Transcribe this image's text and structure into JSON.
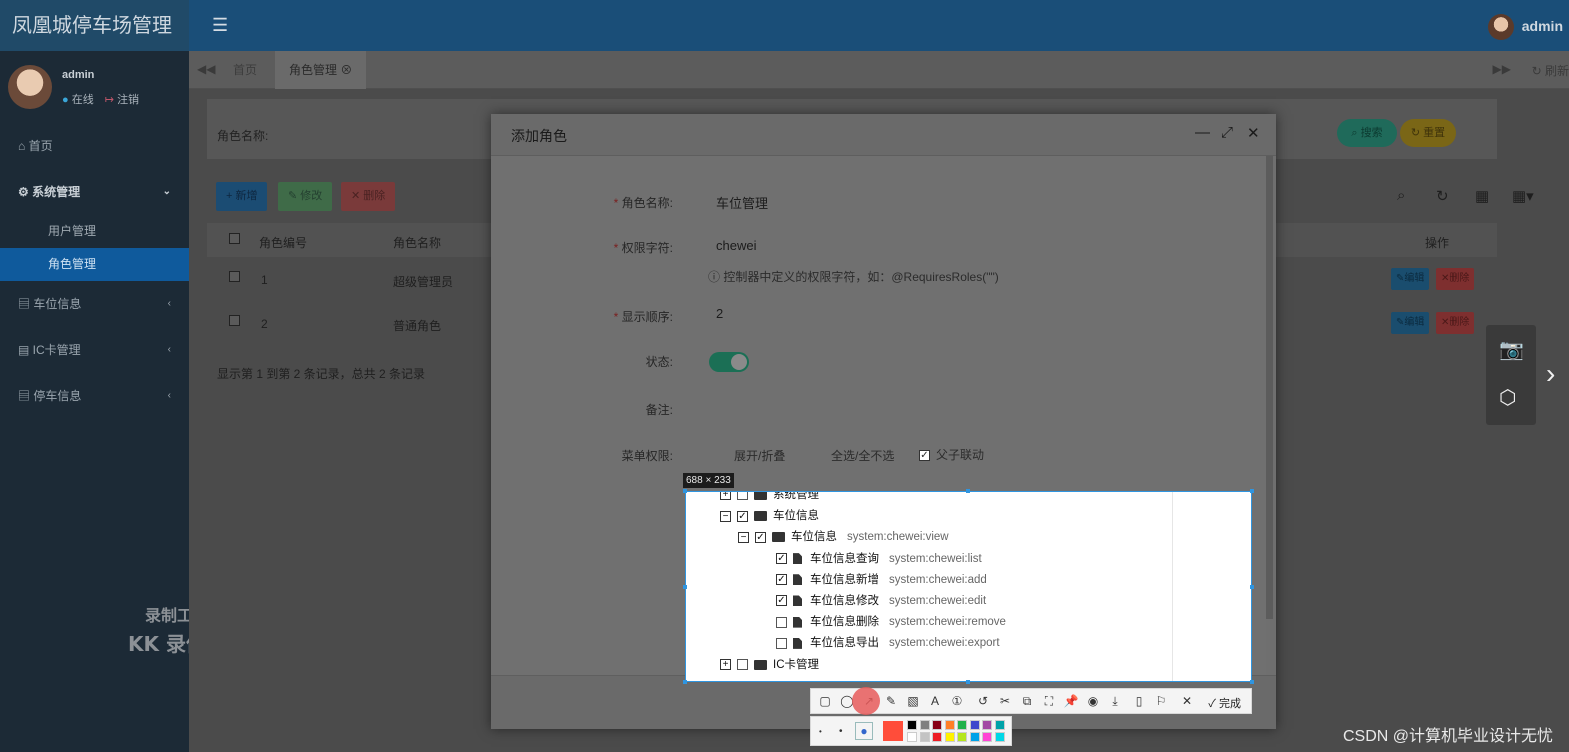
{
  "app": {
    "title": "凤凰城停车场管理",
    "user": "admin"
  },
  "sidebar": {
    "profile": {
      "name": "admin",
      "online": "在线",
      "logout": "注销"
    },
    "items": [
      {
        "label": "首页"
      },
      {
        "label": "系统管理"
      },
      {
        "label": "用户管理"
      },
      {
        "label": "角色管理"
      },
      {
        "label": "车位信息"
      },
      {
        "label": "IC卡管理"
      },
      {
        "label": "停车信息"
      }
    ]
  },
  "watermark": {
    "line1": "录制工具",
    "line2": "KK 录像机"
  },
  "tabs": {
    "home": "首页",
    "active": "角色管理",
    "refresh": "刷新"
  },
  "search": {
    "role_name_label": "角色名称:",
    "search_btn": "搜索",
    "reset_btn": "重置"
  },
  "toolbar": {
    "add": "新增",
    "edit": "修改",
    "delete": "删除"
  },
  "table": {
    "headers": [
      "角色编号",
      "角色名称",
      "操作"
    ],
    "rows": [
      {
        "id": "1",
        "name": "超级管理员",
        "edit": "编辑",
        "del": "删除"
      },
      {
        "id": "2",
        "name": "普通角色",
        "edit": "编辑",
        "del": "删除"
      }
    ],
    "footer": "显示第 1 到第 2 条记录，总共 2 条记录"
  },
  "modal": {
    "title": "添加角色",
    "fields": {
      "role_name_label": "角色名称:",
      "role_name_value": "车位管理",
      "perm_key_label": "权限字符:",
      "perm_key_value": "chewei",
      "perm_hint": "控制器中定义的权限字符，如：@RequiresRoles(\"\")",
      "order_label": "显示顺序:",
      "order_value": "2",
      "status_label": "状态:",
      "status_on": true,
      "remark_label": "备注:",
      "menu_label": "菜单权限:",
      "expand": "展开/折叠",
      "select_all": "全选/全不选",
      "linkage": "父子联动",
      "linkage_checked": true
    }
  },
  "capture": {
    "size_label": "688 × 233",
    "done": "完成",
    "colors": [
      "#ff4d3a",
      "#000000",
      "#7f7f7f",
      "#880015",
      "#ff7f27",
      "#22b14c",
      "#3f48cc",
      "#a349a4",
      "#00a2a8",
      "#ffffff",
      "#c3c3c3",
      "#ed1c24",
      "#fff200",
      "#b5e61d",
      "#00a2e8",
      "#ff44d4",
      "#00d7e6"
    ]
  },
  "tree": [
    {
      "label": "系统管理",
      "checked": false,
      "expanded": false,
      "level": 0,
      "kind": "folder",
      "perm": ""
    },
    {
      "label": "车位信息",
      "checked": true,
      "expanded": true,
      "level": 0,
      "kind": "folder",
      "perm": ""
    },
    {
      "label": "车位信息",
      "checked": true,
      "expanded": true,
      "level": 1,
      "kind": "folder",
      "perm": "system:chewei:view"
    },
    {
      "label": "车位信息查询",
      "checked": true,
      "level": 2,
      "kind": "file",
      "perm": "system:chewei:list"
    },
    {
      "label": "车位信息新增",
      "checked": true,
      "level": 2,
      "kind": "file",
      "perm": "system:chewei:add"
    },
    {
      "label": "车位信息修改",
      "checked": true,
      "level": 2,
      "kind": "file",
      "perm": "system:chewei:edit"
    },
    {
      "label": "车位信息删除",
      "checked": false,
      "level": 2,
      "kind": "file",
      "perm": "system:chewei:remove"
    },
    {
      "label": "车位信息导出",
      "checked": false,
      "level": 2,
      "kind": "file",
      "perm": "system:chewei:export"
    },
    {
      "label": "IC卡管理",
      "checked": false,
      "expanded": false,
      "level": 0,
      "kind": "folder",
      "perm": ""
    }
  ],
  "credit": "CSDN @计算机毕业设计无忧"
}
